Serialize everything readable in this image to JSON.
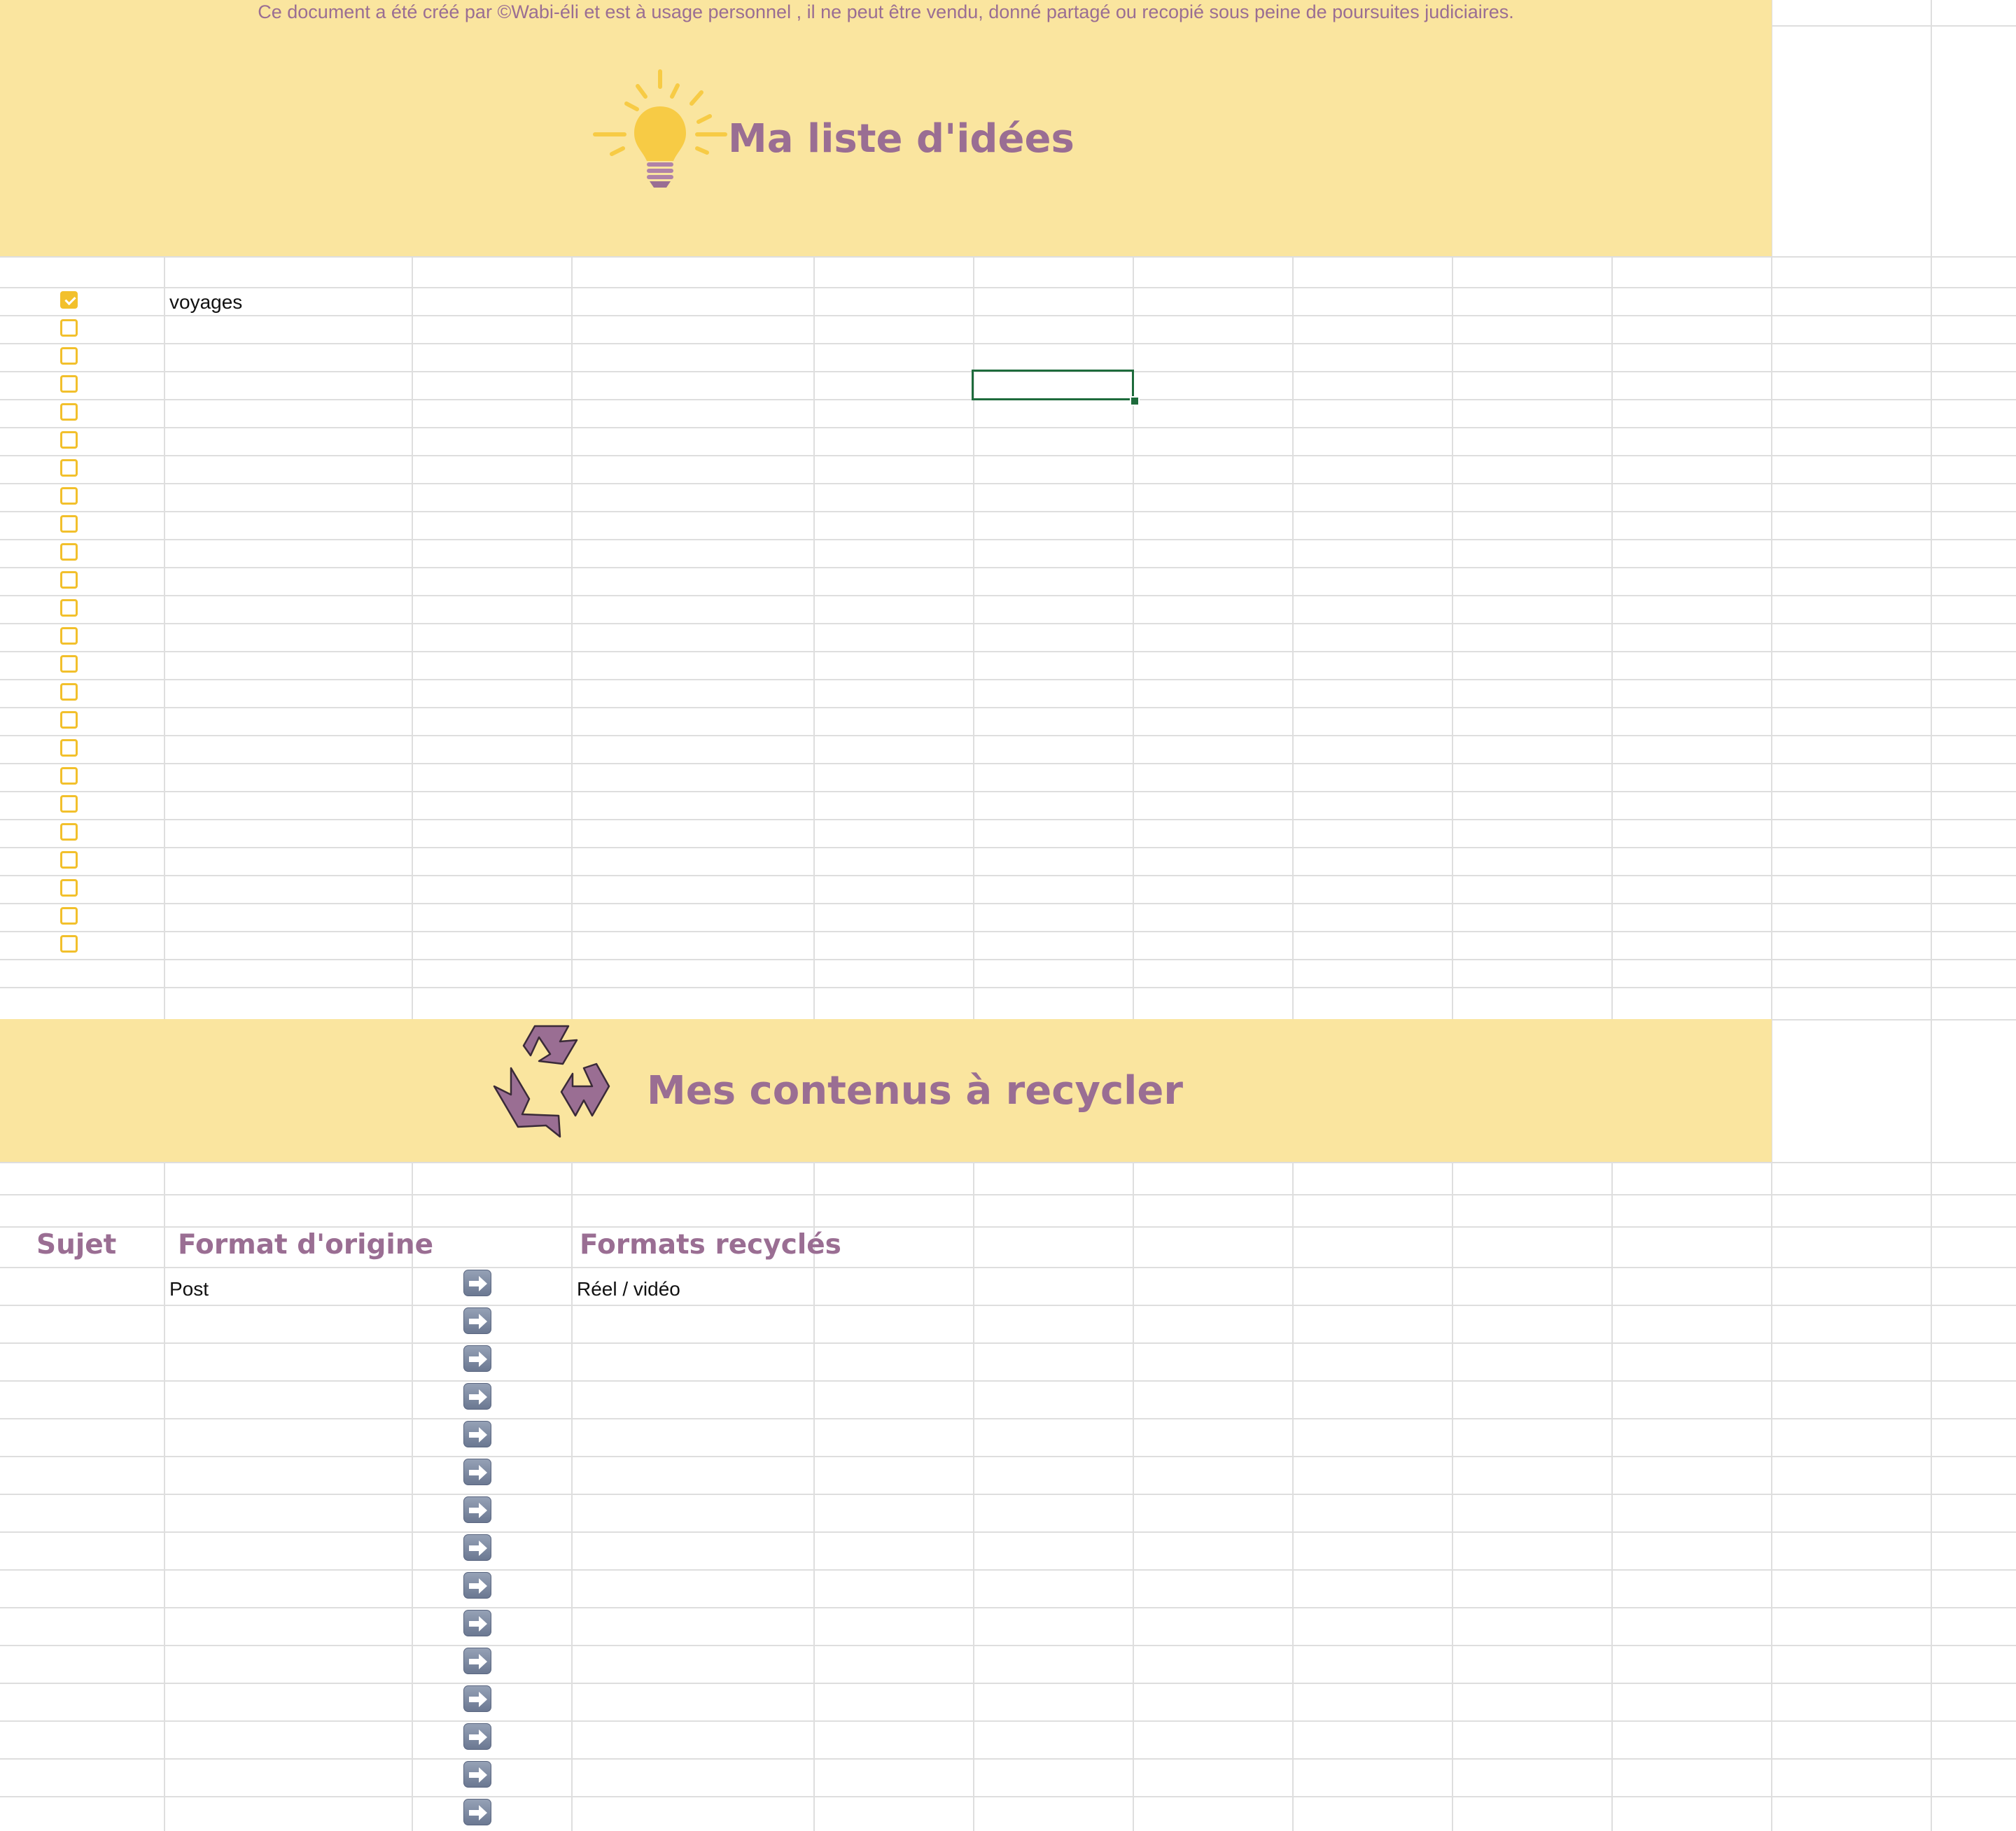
{
  "notice": "Ce document a été créé par ©Wabi-éli et est à usage personnel , il ne peut être vendu, donné partagé ou recopié sous peine de poursuites judiciaires.",
  "ideas": {
    "title": "Ma liste d'idées",
    "items": [
      {
        "checked": true,
        "text": "voyages"
      },
      {
        "checked": false,
        "text": ""
      },
      {
        "checked": false,
        "text": ""
      },
      {
        "checked": false,
        "text": ""
      },
      {
        "checked": false,
        "text": ""
      },
      {
        "checked": false,
        "text": ""
      },
      {
        "checked": false,
        "text": ""
      },
      {
        "checked": false,
        "text": ""
      },
      {
        "checked": false,
        "text": ""
      },
      {
        "checked": false,
        "text": ""
      },
      {
        "checked": false,
        "text": ""
      },
      {
        "checked": false,
        "text": ""
      },
      {
        "checked": false,
        "text": ""
      },
      {
        "checked": false,
        "text": ""
      },
      {
        "checked": false,
        "text": ""
      },
      {
        "checked": false,
        "text": ""
      },
      {
        "checked": false,
        "text": ""
      },
      {
        "checked": false,
        "text": ""
      },
      {
        "checked": false,
        "text": ""
      },
      {
        "checked": false,
        "text": ""
      },
      {
        "checked": false,
        "text": ""
      },
      {
        "checked": false,
        "text": ""
      },
      {
        "checked": false,
        "text": ""
      },
      {
        "checked": false,
        "text": ""
      }
    ]
  },
  "recycle": {
    "title": "Mes contenus à recycler",
    "headers": {
      "subject": "Sujet",
      "origin": "Format d'origine",
      "recycled": "Formats recyclés"
    },
    "rows": [
      {
        "origin": "Post",
        "recycled": "Réel / vidéo"
      },
      {
        "origin": "",
        "recycled": ""
      },
      {
        "origin": "",
        "recycled": ""
      },
      {
        "origin": "",
        "recycled": ""
      },
      {
        "origin": "",
        "recycled": ""
      },
      {
        "origin": "",
        "recycled": ""
      },
      {
        "origin": "",
        "recycled": ""
      },
      {
        "origin": "",
        "recycled": ""
      },
      {
        "origin": "",
        "recycled": ""
      },
      {
        "origin": "",
        "recycled": ""
      },
      {
        "origin": "",
        "recycled": ""
      },
      {
        "origin": "",
        "recycled": ""
      },
      {
        "origin": "",
        "recycled": ""
      },
      {
        "origin": "",
        "recycled": ""
      },
      {
        "origin": "",
        "recycled": ""
      }
    ]
  },
  "icons": {
    "bulb": "lightbulb-icon",
    "recycle": "recycle-icon",
    "arrow": "arrow-right-icon",
    "checkbox": "checkbox-icon"
  },
  "colors": {
    "band": "#fae59f",
    "title": "#9a6e93",
    "checkbox": "#f2c02c",
    "grid": "#dedede",
    "selection": "#1e6b3c"
  }
}
